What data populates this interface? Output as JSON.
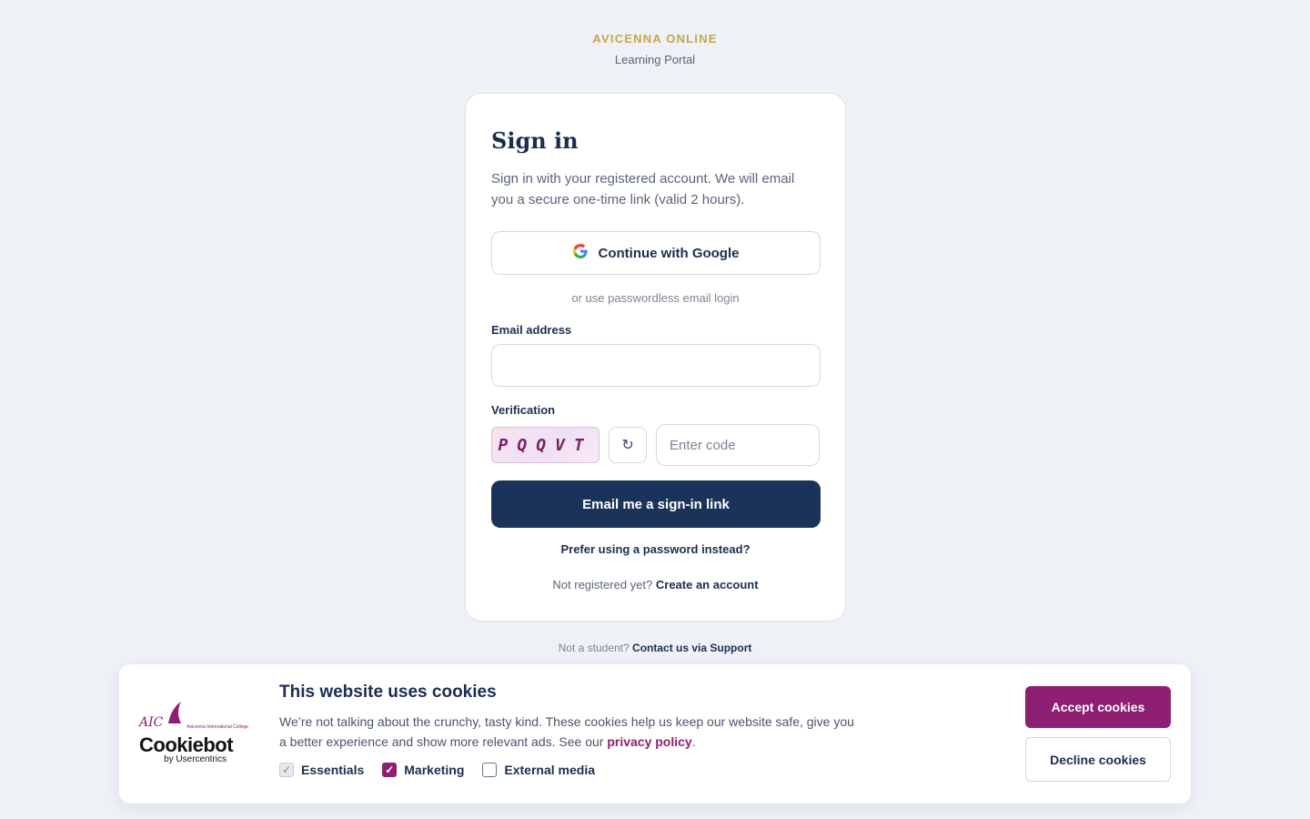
{
  "brand": {
    "name": "AVICENNA ONLINE",
    "subtitle": "Learning Portal"
  },
  "signin": {
    "title": "Sign in",
    "description": "Sign in with your registered account. We will email you a secure one-time link (valid 2 hours).",
    "google_button": "Continue with Google",
    "divider": "or use passwordless email login",
    "email_label": "Email address",
    "email_value": "",
    "verification_label": "Verification",
    "captcha_text": "PQQVT",
    "code_placeholder": "Enter code",
    "submit_button": "Email me a sign-in link",
    "password_link": "Prefer using a password instead?",
    "register_prompt": "Not registered yet?",
    "register_link": "Create an account"
  },
  "support": {
    "prompt": "Not a student?",
    "link": "Contact us via Support"
  },
  "cookie_banner": {
    "logo_text": "AIC",
    "logo_subtext": "Avicenna International College",
    "provider": "Cookiebot",
    "provider_sub": "by Usercentrics",
    "title": "This website uses cookies",
    "text_before_link": "We’re not talking about the crunchy, tasty kind. These cookies help us keep our website safe, give you a better experience and show more relevant ads. See our",
    "link_text": "privacy policy",
    "text_after_link": ".",
    "options": [
      {
        "label": "Essentials",
        "checked": true,
        "disabled": true
      },
      {
        "label": "Marketing",
        "checked": true,
        "disabled": false
      },
      {
        "label": "External media",
        "checked": false,
        "disabled": false
      }
    ],
    "accept_button": "Accept cookies",
    "decline_button": "Decline cookies"
  },
  "colors": {
    "primary": "#1c3359",
    "accent": "#8e1f72",
    "brand_gold": "#c9a54a"
  }
}
